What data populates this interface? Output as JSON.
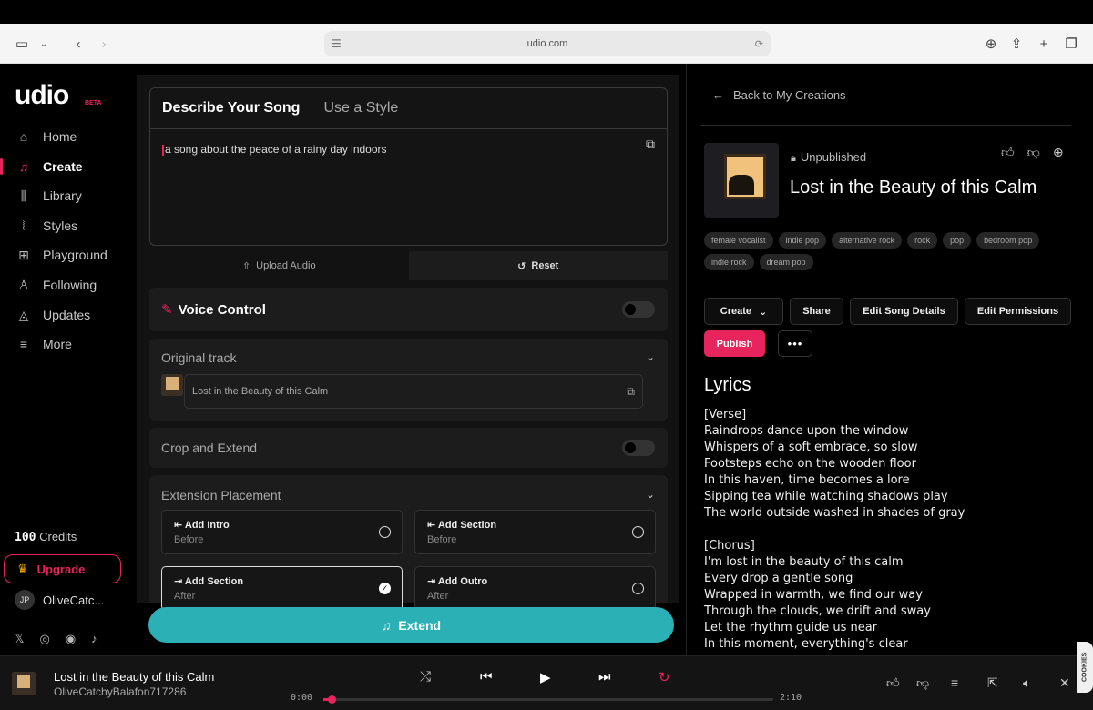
{
  "browser": {
    "url": "udio.com"
  },
  "sidebar": {
    "logo": "udio",
    "beta": "BETA",
    "items": [
      {
        "label": "Home"
      },
      {
        "label": "Create"
      },
      {
        "label": "Library"
      },
      {
        "label": "Styles"
      },
      {
        "label": "Playground"
      },
      {
        "label": "Following"
      },
      {
        "label": "Updates"
      },
      {
        "label": "More"
      }
    ],
    "credits_value": "100",
    "credits_label": "Credits",
    "upgrade": "Upgrade",
    "user_initials": "JP",
    "user_name": "OliveCatc..."
  },
  "create": {
    "tabs": [
      "Describe Your Song",
      "Use a Style"
    ],
    "prompt": "a song about the peace of a rainy day indoors",
    "upload": "Upload Audio",
    "reset": "Reset",
    "voice_control": "Voice Control",
    "original_track": "Original track",
    "track_name": "Lost in the Beauty of this Calm",
    "crop_extend": "Crop and Extend",
    "extension_placement": "Extension Placement",
    "options": [
      {
        "title": "Add Intro",
        "sub": "Before"
      },
      {
        "title": "Add Section",
        "sub": "Before"
      },
      {
        "title": "Add Section",
        "sub": "After"
      },
      {
        "title": "Add Outro",
        "sub": "After"
      }
    ],
    "extend": "Extend"
  },
  "song": {
    "back": "Back to My Creations",
    "status": "Unpublished",
    "title": "Lost in the Beauty of this Calm",
    "tags": [
      "female vocalist",
      "indie pop",
      "alternative rock",
      "rock",
      "pop",
      "bedroom pop",
      "indie rock",
      "dream pop"
    ],
    "buttons": {
      "create": "Create",
      "share": "Share",
      "edit_details": "Edit Song Details",
      "edit_permissions": "Edit Permissions",
      "publish": "Publish"
    },
    "lyrics_heading": "Lyrics",
    "lyrics": [
      "[Verse]",
      "Raindrops dance upon the window",
      "Whispers of a soft embrace, so slow",
      "Footsteps echo on the wooden floor",
      "In this haven, time becomes a lore",
      "Sipping tea while watching shadows play",
      "The world outside washed in shades of gray",
      "",
      "[Chorus]",
      "I'm lost in the beauty of this calm",
      "Every drop a gentle song",
      "Wrapped in warmth, we find our way",
      "Through the clouds, we drift and sway",
      "Let the rhythm guide us near",
      "In this moment, everything's clear"
    ]
  },
  "player": {
    "title": "Lost in the Beauty of this Calm",
    "artist": "OliveCatchyBalafon717286",
    "current": "0:00",
    "duration": "2:10",
    "progress": 0.01
  },
  "cookies": "COOKIES"
}
